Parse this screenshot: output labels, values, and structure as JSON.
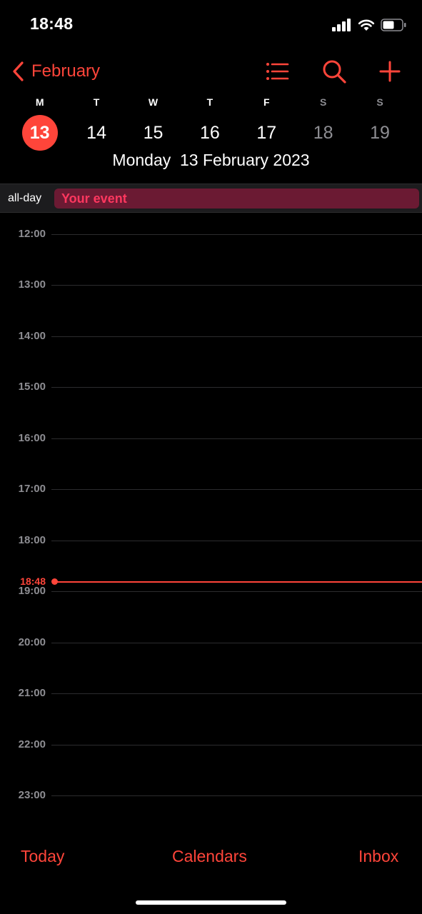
{
  "status_bar": {
    "time": "18:48"
  },
  "nav": {
    "back_label": "February",
    "icons": [
      "chevron-left-icon",
      "list-icon",
      "search-icon",
      "plus-icon"
    ]
  },
  "week": {
    "weekdays": [
      "M",
      "T",
      "W",
      "T",
      "F",
      "S",
      "S"
    ],
    "dates": [
      "13",
      "14",
      "15",
      "16",
      "17",
      "18",
      "19"
    ],
    "selected_index": 0,
    "weekend_indices": [
      5,
      6
    ],
    "full_date": "Monday  13 February 2023"
  },
  "all_day": {
    "label": "all-day",
    "event_title": "Your event"
  },
  "timeline": {
    "hours": [
      "12:00",
      "13:00",
      "14:00",
      "15:00",
      "16:00",
      "17:00",
      "18:00",
      "19:00",
      "20:00",
      "21:00",
      "22:00",
      "23:00"
    ],
    "current_time": "18:48"
  },
  "toolbar": {
    "today": "Today",
    "calendars": "Calendars",
    "inbox": "Inbox"
  },
  "colors": {
    "accent": "#ff453a",
    "event_bg": "#6b1a33",
    "event_text": "#ff375f",
    "muted": "#8e8e93",
    "background": "#000000"
  }
}
